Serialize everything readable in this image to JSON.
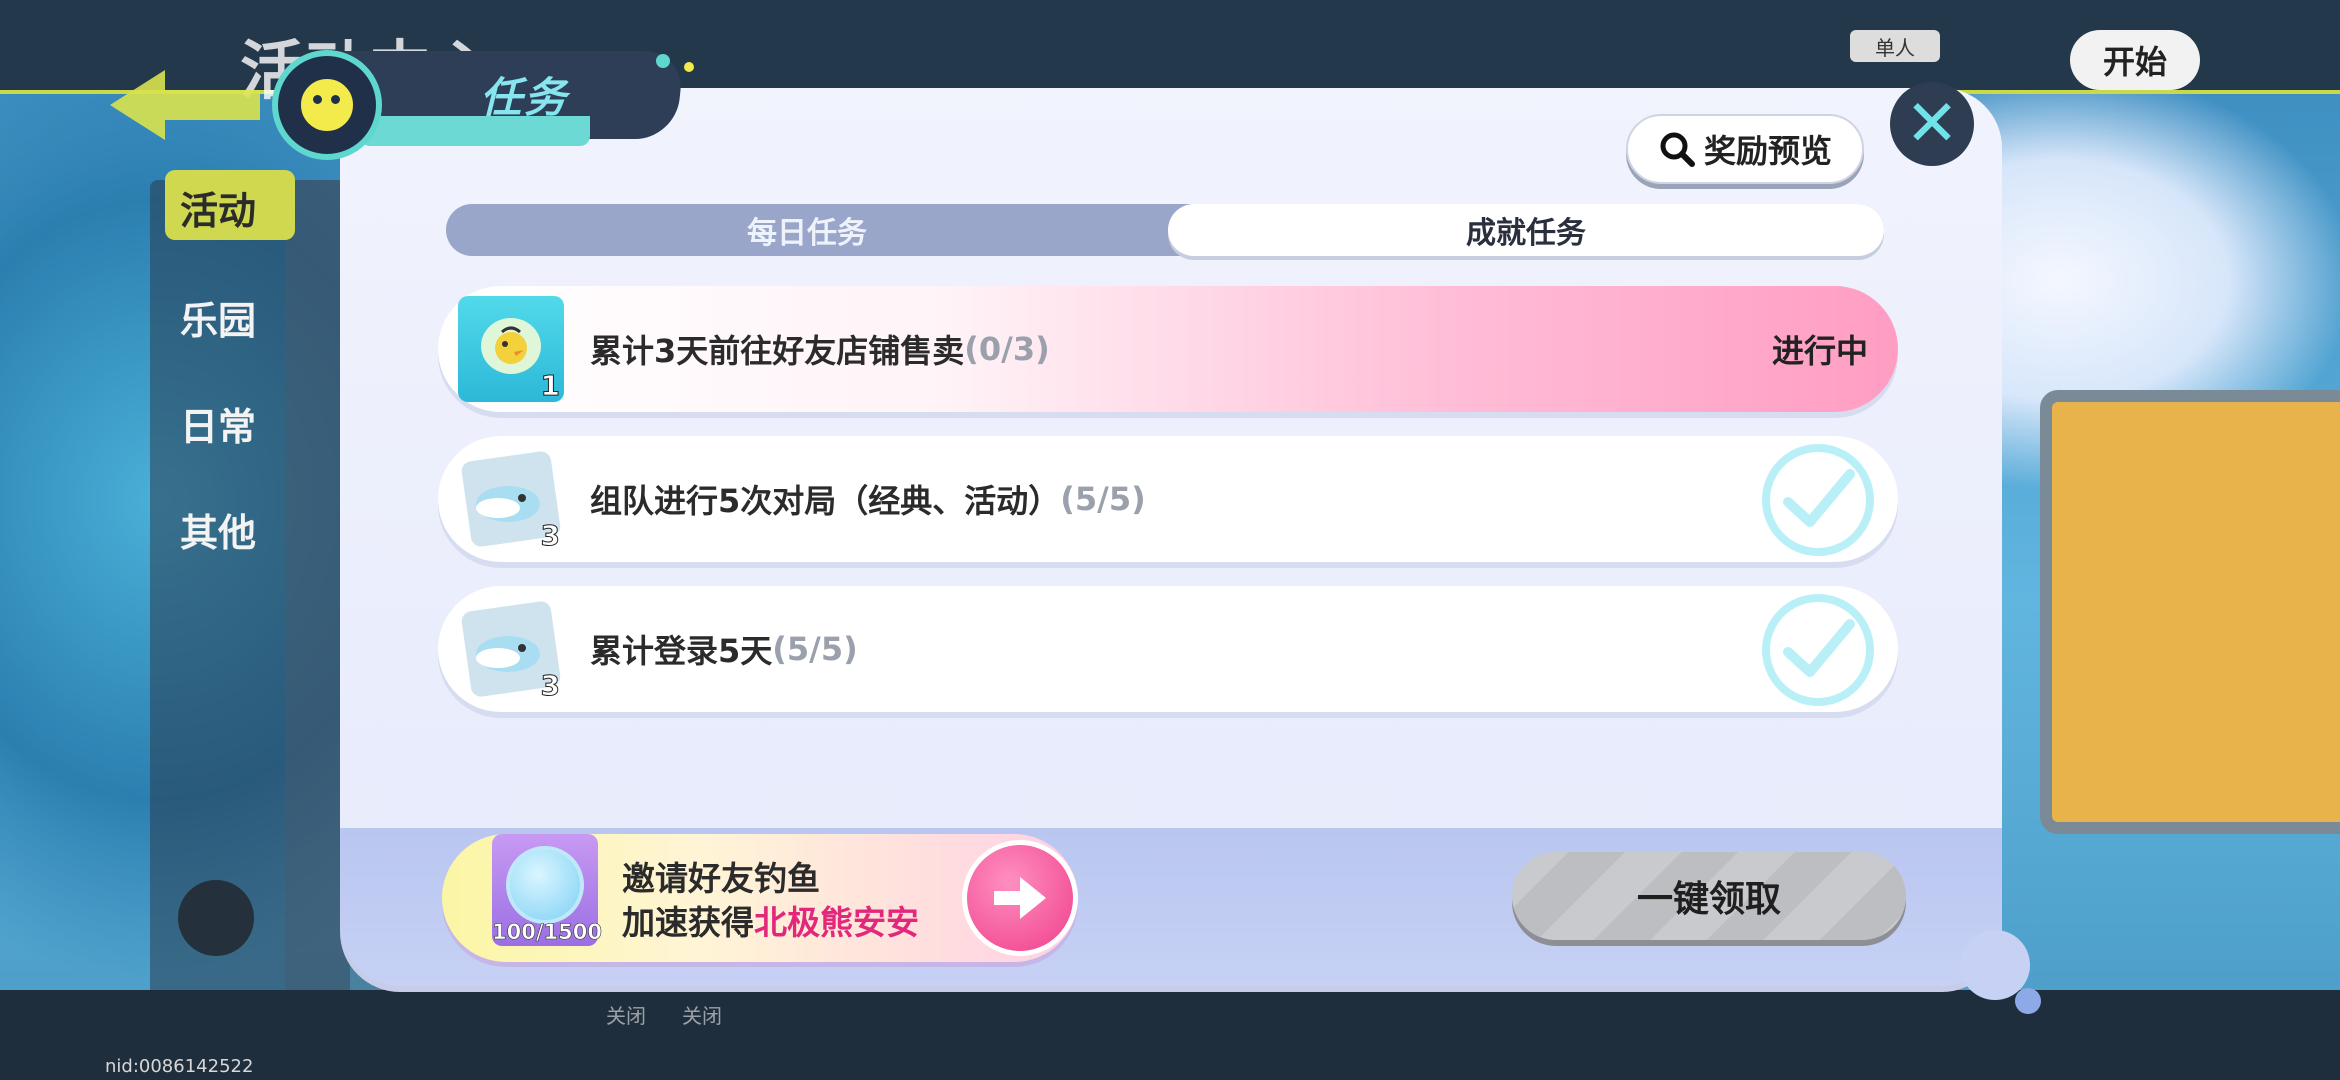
{
  "background": {
    "activity_center_title": "活动中心",
    "single_label": "单人",
    "start_label": "开始",
    "side_items": [
      "活动",
      "乐园",
      "日常",
      "其他"
    ],
    "nid": "nid:0086142522",
    "bottom_labels": [
      "关闭",
      "关闭"
    ]
  },
  "dialog": {
    "title": "任务",
    "reward_preview_label": "奖励预览",
    "tabs": [
      {
        "label": "每日任务",
        "selected": true
      },
      {
        "label": "成就任务",
        "selected": false
      }
    ],
    "tasks": [
      {
        "text": "累计3天前往好友店铺售卖",
        "progress": "(0/3)",
        "reward_count": "1",
        "status": "进行中",
        "reward_icon": "duck-badge-icon"
      },
      {
        "text": "组队进行5次对局（经典、活动）",
        "progress": "(5/5)",
        "reward_count": "3",
        "status": "completed",
        "reward_icon": "fish-pack-icon"
      },
      {
        "text": "累计登录5天",
        "progress": "(5/5)",
        "reward_count": "3",
        "status": "completed",
        "reward_icon": "fish-pack-icon"
      }
    ],
    "invite": {
      "line1": "邀请好友钓鱼",
      "line2_prefix": "加速获得",
      "line2_highlight": "北极熊安安",
      "count": "100/1500"
    },
    "claim_all_label": "一键领取",
    "colors": {
      "accent_teal": "#6fe3e8",
      "active_pink": "#ff9dc3",
      "highlight_pink": "#e2287a",
      "check_cyan": "#b9f0f8"
    }
  }
}
